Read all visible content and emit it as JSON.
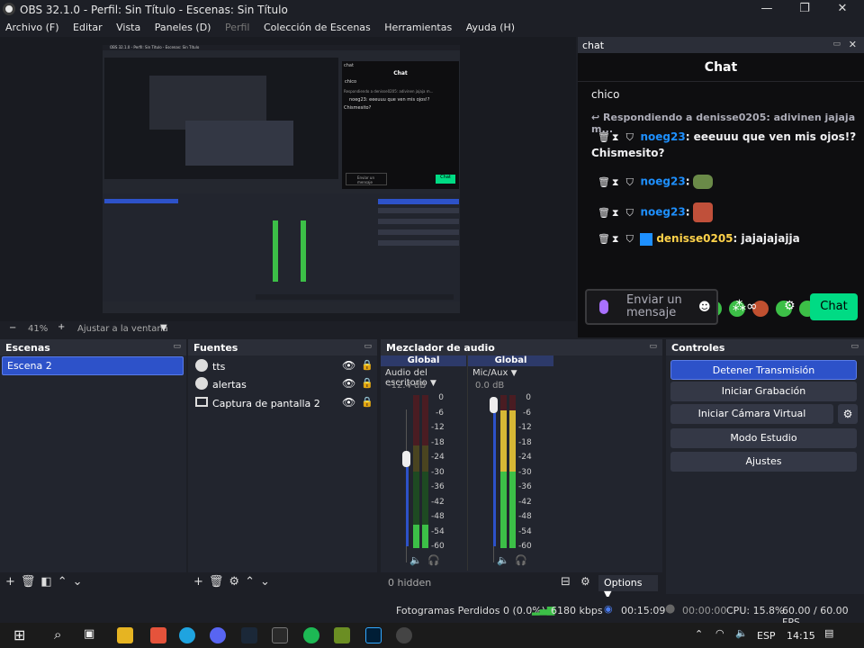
{
  "window": {
    "title": "OBS 32.1.0 - Perfil: Sin Título - Escenas: Sin Título",
    "minimize": "—",
    "maximize": "❐",
    "close": "✕"
  },
  "menu": [
    "Archivo (F)",
    "Editar",
    "Vista",
    "Paneles (D)",
    "Perfil",
    "Colección de Escenas",
    "Herramientas",
    "Ayuda (H)"
  ],
  "preview": {
    "zoom": "41%",
    "minus": "−",
    "plus": "+",
    "fit": "Ajustar a la ventana",
    "mini_title": "OBS 32.1.0 - Perfil: Sin Título - Escenas: Sin Título",
    "mini_chat_title": "chat",
    "mini_chat_header": "Chat",
    "mini_chat_line": "chico",
    "mini_chat_reply": "Respondiendo a denisse0205: adivinen jajaja m...",
    "mini_chat_msg": "noeg23: eeeuuu que ven mis ojos!?",
    "mini_chat_msg2": "Chismesito?",
    "mini_send": "Enviar un mensaje",
    "mini_chat_btn": "Chat"
  },
  "chat": {
    "dock_title": "chat",
    "header": "Chat",
    "line1": "chico",
    "reply": "Respondiendo a denisse0205: adivinen jajaja m...",
    "msg1_user": "noeg23",
    "msg1_text": ": eeeuuu que ven mis ojos!?",
    "msg1_cont": "Chismesito?",
    "msg2_user": "noeg23",
    "msg3_user": "noeg23",
    "msg4_user": "denisse0205",
    "msg4_text": ": jajajajajja",
    "sep": ":",
    "input_placeholder": "Enviar un mensaje",
    "chat_button": "Chat"
  },
  "scenes": {
    "title": "Escenas",
    "items": [
      "Escena 2"
    ]
  },
  "sources": {
    "title": "Fuentes",
    "items": [
      "tts",
      "alertas",
      "Captura de pantalla 2"
    ]
  },
  "mixer": {
    "title": "Mezclador de audio",
    "tracks": [
      {
        "header": "Global",
        "name": "Audio del escritorio",
        "db": "-12.4 dB",
        "level": 0.15
      },
      {
        "header": "Global",
        "name": "Mic/Aux",
        "db": "0.0 dB",
        "level": 0.9
      }
    ],
    "scale": [
      "0",
      "-6",
      "-12",
      "-18",
      "-24",
      "-30",
      "-36",
      "-42",
      "-48",
      "-54",
      "-60"
    ],
    "hidden": "0 hidden",
    "options": "Options"
  },
  "controls": {
    "title": "Controles",
    "buttons": [
      "Detener Transmisión",
      "Iniciar Grabación",
      "Iniciar Cámara Virtual",
      "Modo Estudio",
      "Ajustes"
    ]
  },
  "status": {
    "dropped": "Fotogramas Perdidos 0 (0.0%)",
    "bitrate": "6180 kbps",
    "stream_time": "00:15:09",
    "rec_time": "00:00:00",
    "cpu": "CPU: 15.8%",
    "fps": "60.00 / 60.00 FPS"
  },
  "taskbar": {
    "lang": "ESP",
    "clock": "14:15"
  },
  "colors": {
    "accent": "#2d52c9",
    "twitch_purple": "#9147ff",
    "chat_green": "#00db84",
    "meter_green": "#3cbf47",
    "meter_yellow": "#d6b735",
    "meter_red": "#b3303a"
  }
}
